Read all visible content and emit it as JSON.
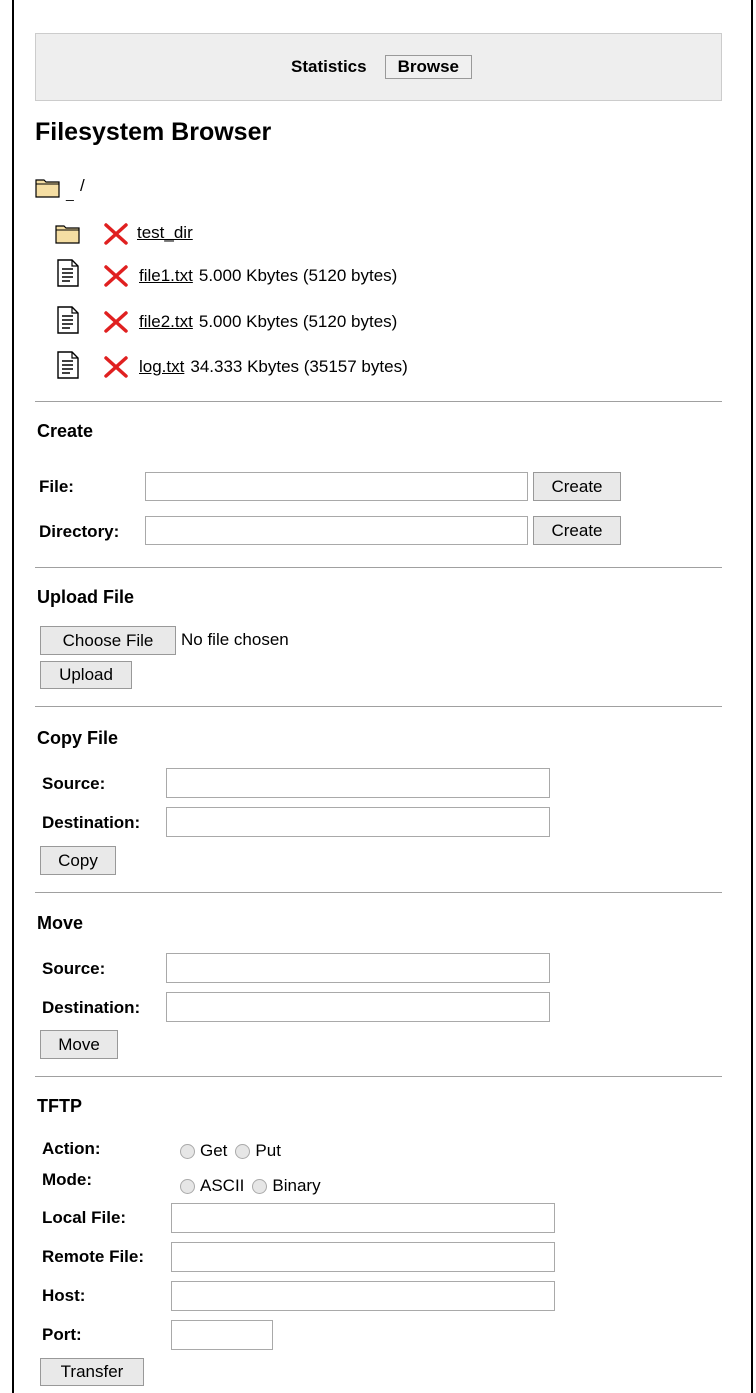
{
  "nav": {
    "statistics": "Statistics",
    "browse": "Browse"
  },
  "title": "Filesystem Browser",
  "browser": {
    "path": "/",
    "entries": [
      {
        "type": "folder",
        "name": "test_dir",
        "size": ""
      },
      {
        "type": "file",
        "name": "file1.txt",
        "size": "5.000 Kbytes (5120 bytes)"
      },
      {
        "type": "file",
        "name": "file2.txt",
        "size": "5.000 Kbytes (5120 bytes)"
      },
      {
        "type": "file",
        "name": "log.txt",
        "size": "34.333 Kbytes (35157 bytes)"
      }
    ]
  },
  "create": {
    "title": "Create",
    "file_label": "File:",
    "dir_label": "Directory:",
    "create_button": "Create"
  },
  "upload": {
    "title": "Upload File",
    "choose_button": "Choose File",
    "status": "No file chosen",
    "upload_button": "Upload"
  },
  "copy": {
    "title": "Copy File",
    "source_label": "Source:",
    "dest_label": "Destination:",
    "button": "Copy"
  },
  "move": {
    "title": "Move",
    "source_label": "Source:",
    "dest_label": "Destination:",
    "button": "Move"
  },
  "tftp": {
    "title": "TFTP",
    "action_label": "Action:",
    "action_get": "Get",
    "action_put": "Put",
    "mode_label": "Mode:",
    "mode_ascii": "ASCII",
    "mode_binary": "Binary",
    "local_label": "Local File:",
    "remote_label": "Remote File:",
    "host_label": "Host:",
    "port_label": "Port:",
    "button": "Transfer"
  },
  "icons": {
    "folder": "folder-icon",
    "file": "file-icon",
    "delete": "delete-icon",
    "colors": {
      "folder_fill": "#f5dea3",
      "delete": "#e02020"
    }
  }
}
